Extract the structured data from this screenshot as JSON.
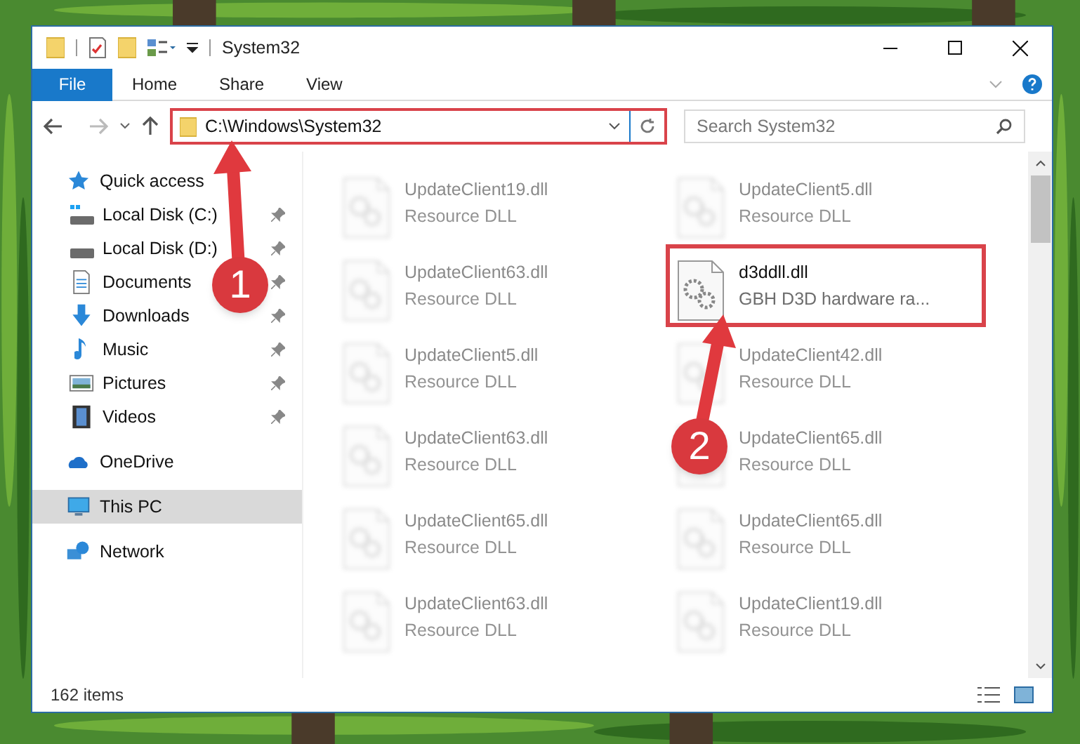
{
  "window": {
    "title": "System32"
  },
  "ribbon": {
    "tabs": [
      {
        "label": "File",
        "kind": "file"
      },
      {
        "label": "Home",
        "kind": "tab"
      },
      {
        "label": "Share",
        "kind": "tab"
      },
      {
        "label": "View",
        "kind": "tab"
      }
    ]
  },
  "address_bar": {
    "path": "C:\\Windows\\System32",
    "highlighted": true
  },
  "search": {
    "placeholder": "Search System32"
  },
  "sidebar": {
    "items": [
      {
        "label": "Quick access",
        "selected": false,
        "children": [
          {
            "label": "Local Disk (C:)",
            "pinned": true,
            "selected": false
          },
          {
            "label": "Local Disk (D:)",
            "pinned": true,
            "selected": false
          },
          {
            "label": "Documents",
            "pinned": true,
            "selected": false
          },
          {
            "label": "Downloads",
            "pinned": true,
            "selected": false
          },
          {
            "label": "Music",
            "pinned": true,
            "selected": false
          },
          {
            "label": "Pictures",
            "pinned": true,
            "selected": false
          },
          {
            "label": "Videos",
            "pinned": true,
            "selected": false
          }
        ]
      },
      {
        "label": "OneDrive",
        "selected": false
      },
      {
        "label": "This PC",
        "selected": true
      },
      {
        "label": "Network",
        "selected": false
      }
    ]
  },
  "files": [
    {
      "name": "UpdateClient19.dll",
      "type": "Resource DLL",
      "blurred": true,
      "highlighted": false
    },
    {
      "name": "UpdateClient5.dll",
      "type": "Resource DLL",
      "blurred": true,
      "highlighted": false
    },
    {
      "name": "UpdateClient63.dll",
      "type": "Resource DLL",
      "blurred": true,
      "highlighted": false
    },
    {
      "name": "d3ddll.dll",
      "type": "GBH D3D hardware ra...",
      "blurred": false,
      "highlighted": true
    },
    {
      "name": "UpdateClient5.dll",
      "type": "Resource DLL",
      "blurred": true,
      "highlighted": false
    },
    {
      "name": "UpdateClient42.dll",
      "type": "Resource DLL",
      "blurred": true,
      "highlighted": false
    },
    {
      "name": "UpdateClient63.dll",
      "type": "Resource DLL",
      "blurred": true,
      "highlighted": false
    },
    {
      "name": "UpdateClient65.dll",
      "type": "Resource DLL",
      "blurred": true,
      "highlighted": false
    },
    {
      "name": "UpdateClient65.dll",
      "type": "Resource DLL",
      "blurred": true,
      "highlighted": false
    },
    {
      "name": "UpdateClient65.dll",
      "type": "Resource DLL",
      "blurred": true,
      "highlighted": false
    },
    {
      "name": "UpdateClient63.dll",
      "type": "Resource DLL",
      "blurred": true,
      "highlighted": false
    },
    {
      "name": "UpdateClient19.dll",
      "type": "Resource DLL",
      "blurred": true,
      "highlighted": false
    }
  ],
  "annotations": [
    {
      "number": "1"
    },
    {
      "number": "2"
    }
  ],
  "status_bar": {
    "item_count": "162 items"
  }
}
